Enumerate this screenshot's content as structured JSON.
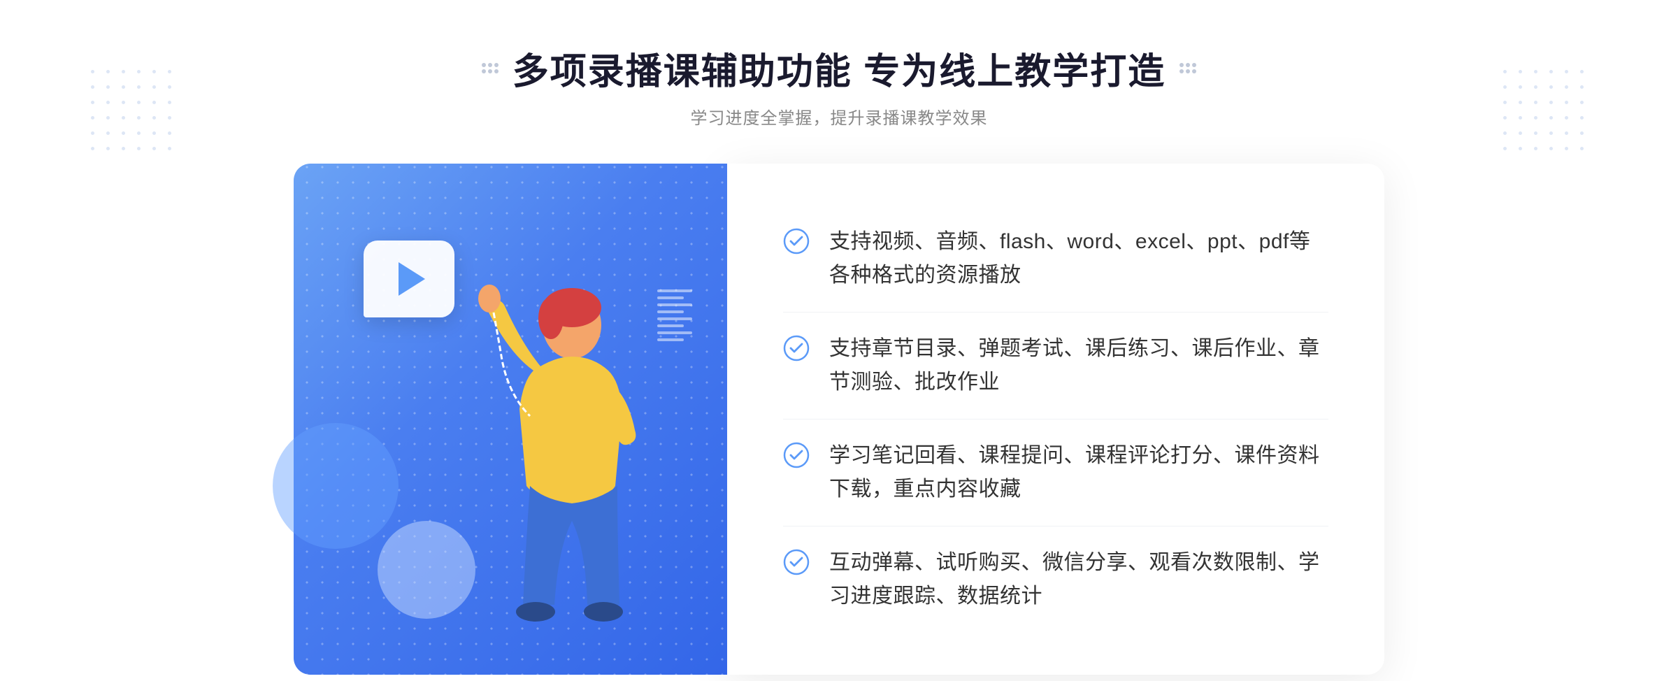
{
  "header": {
    "title": "多项录播课辅助功能 专为线上教学打造",
    "subtitle": "学习进度全掌握，提升录播课教学效果"
  },
  "features": [
    {
      "id": "feature-1",
      "text": "支持视频、音频、flash、word、excel、ppt、pdf等各种格式的资源播放"
    },
    {
      "id": "feature-2",
      "text": "支持章节目录、弹题考试、课后练习、课后作业、章节测验、批改作业"
    },
    {
      "id": "feature-3",
      "text": "学习笔记回看、课程提问、课程评论打分、课件资料下载，重点内容收藏"
    },
    {
      "id": "feature-4",
      "text": "互动弹幕、试听购买、微信分享、观看次数限制、学习进度跟踪、数据统计"
    }
  ],
  "decorative": {
    "chevron": "»"
  }
}
